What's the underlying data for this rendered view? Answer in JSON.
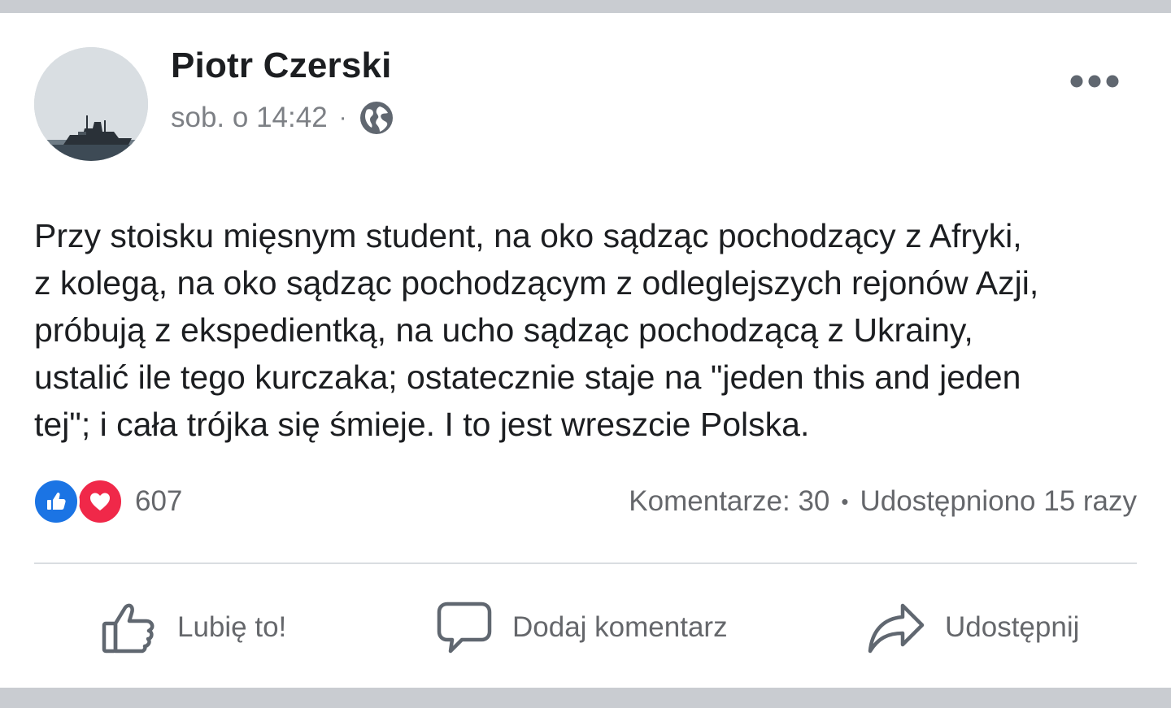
{
  "post": {
    "author": "Piotr Czerski",
    "timestamp": "sob. o 14:42",
    "separator": "·",
    "privacy_icon": "globe-icon",
    "text_lines": [
      "Przy stoisku mięsnym student, na oko sądząc pochodzący z Afryki,",
      "z kolegą, na oko sądząc pochodzącym z odleglejszych rejonów Azji,",
      "próbują z ekspedientką, na ucho sądząc pochodzącą z Ukrainy,",
      "ustalić ile tego kurczaka; ostatecznie staje na \"jeden this and jeden",
      "tej\"; i cała trójka się śmieje. I to jest wreszcie Polska."
    ]
  },
  "reactions": {
    "count": "607",
    "types": [
      "like-icon",
      "love-icon"
    ]
  },
  "stats": {
    "comments": "Komentarze: 30",
    "dot": "•",
    "shares": "Udostępniono 15 razy"
  },
  "actions": {
    "like": "Lubię to!",
    "comment": "Dodaj komentarz",
    "share": "Udostępnij"
  },
  "colors": {
    "like_blue": "#1b74e4",
    "love_red": "#f02849",
    "secondary_text": "#65676b",
    "primary_text": "#1c1e21"
  }
}
